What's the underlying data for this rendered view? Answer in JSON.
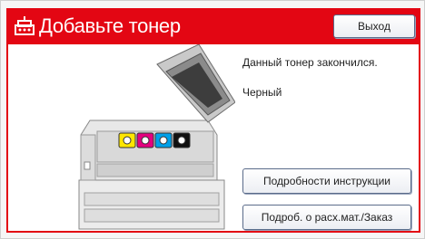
{
  "title": "Добавьте тонер",
  "title_icon": "toner-alert-icon",
  "buttons": {
    "exit": "Выход",
    "instructions": "Подробности инструкции",
    "order": "Подроб. о расх.мат./Заказ"
  },
  "message": "Данный тонер закончился.",
  "toner_color": "Черный",
  "colors": {
    "title_bar": "#e30613",
    "yellow": "#ffe600",
    "magenta": "#e4007f",
    "cyan": "#00a0e9",
    "black": "#111111"
  },
  "toner_slots": [
    "yellow",
    "magenta",
    "cyan",
    "black"
  ]
}
